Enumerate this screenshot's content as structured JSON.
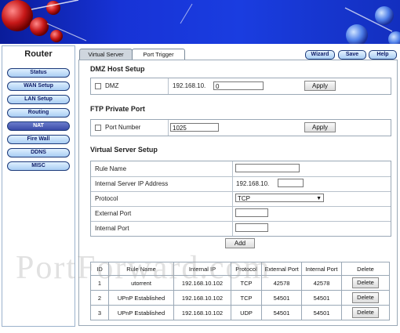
{
  "colors": {
    "banner": "#1733d6",
    "nav_active": "#3a4ba8",
    "nav_button": "#a9cdf3"
  },
  "sidebar": {
    "title": "Router",
    "items": [
      "Status",
      "WAN Setup",
      "LAN Setup",
      "Routing",
      "NAT",
      "Fire Wall",
      "DDNS",
      "MISC"
    ],
    "active": "NAT"
  },
  "tabs": [
    "Virtual Server",
    "Port Trigger"
  ],
  "top_buttons": {
    "wizard": "Wizard",
    "save": "Save",
    "help": "Help"
  },
  "dmz": {
    "title": "DMZ Host Setup",
    "checkbox_label": "DMZ",
    "ip_prefix": "192.168.10.",
    "ip_last": "0",
    "apply": "Apply"
  },
  "ftp": {
    "title": "FTP Private Port",
    "checkbox_label": "Port Number",
    "port": "1025",
    "apply": "Apply"
  },
  "virtual_server": {
    "title": "Virtual Server Setup",
    "rule_name_label": "Rule Name",
    "ip_label": "Internal Server IP Address",
    "ip_prefix": "192.168.10.",
    "protocol_label": "Protocol",
    "protocol_value": "TCP",
    "external_port_label": "External Port",
    "internal_port_label": "Internal Port",
    "add": "Add"
  },
  "table": {
    "headers": [
      "ID",
      "Rule Name",
      "Internal IP",
      "Protocol",
      "External Port",
      "Internal Port",
      "Delete"
    ],
    "rows": [
      [
        "1",
        "utorrent",
        "192.168.10.102",
        "TCP",
        "42578",
        "42578"
      ],
      [
        "2",
        "UPnP Established",
        "192.168.10.102",
        "TCP",
        "54501",
        "54501"
      ],
      [
        "3",
        "UPnP Established",
        "192.168.10.102",
        "UDP",
        "54501",
        "54501"
      ]
    ],
    "delete_label": "Delete"
  },
  "watermark": "PortForward.com"
}
